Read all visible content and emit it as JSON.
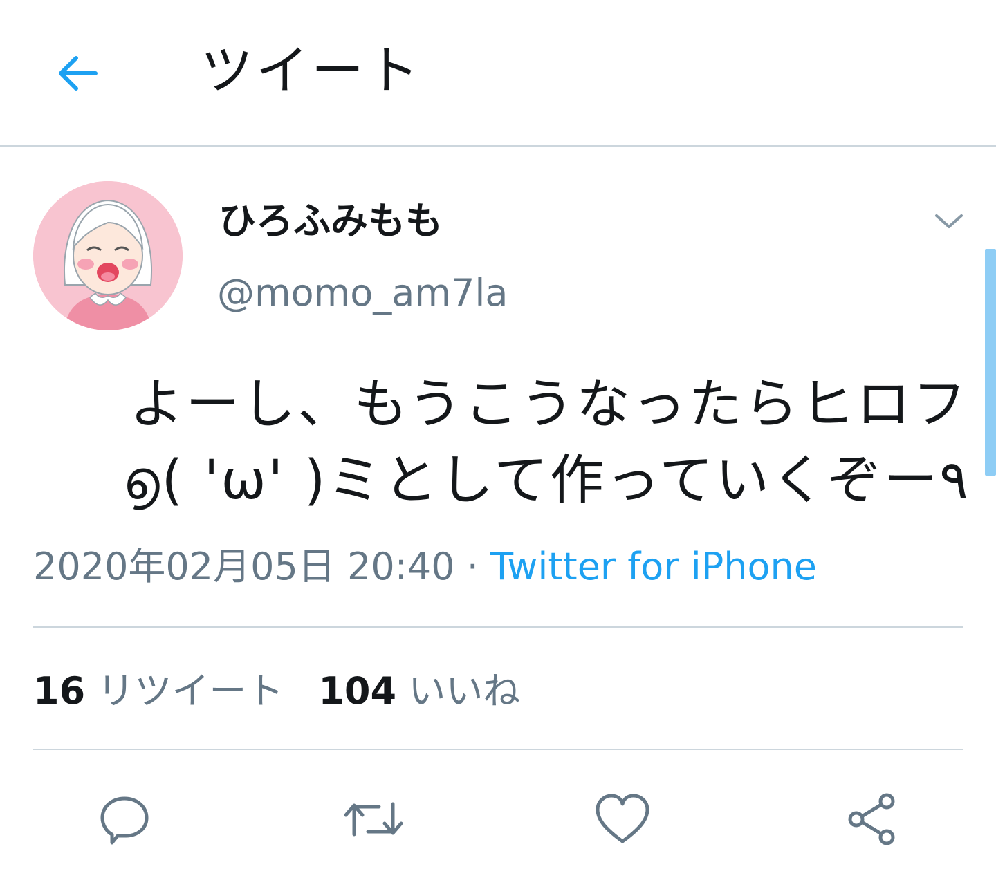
{
  "header": {
    "title": "ツイート",
    "back_icon": "arrow-left-icon"
  },
  "colors": {
    "accent": "#1da1f2",
    "text_primary": "#14171a",
    "text_secondary": "#657786",
    "divider": "#ccd6dd"
  },
  "tweet": {
    "display_name": "ひろふみもも",
    "username": "@momo_am7la",
    "text_line1": "よーし、もうこうなったらヒロフ",
    "text_line2": "൭( 'ω' )ミとして作っていくぞー٩",
    "timestamp": "2020年02月05日 20:40",
    "separator": " · ",
    "source": "Twitter for iPhone",
    "retweet_count": "16",
    "retweet_label": "リツイート",
    "like_count": "104",
    "like_label": "いいね"
  },
  "actions": [
    {
      "name": "reply",
      "icon": "reply-icon"
    },
    {
      "name": "retweet",
      "icon": "retweet-icon"
    },
    {
      "name": "like",
      "icon": "heart-icon"
    },
    {
      "name": "share",
      "icon": "share-icon"
    }
  ]
}
